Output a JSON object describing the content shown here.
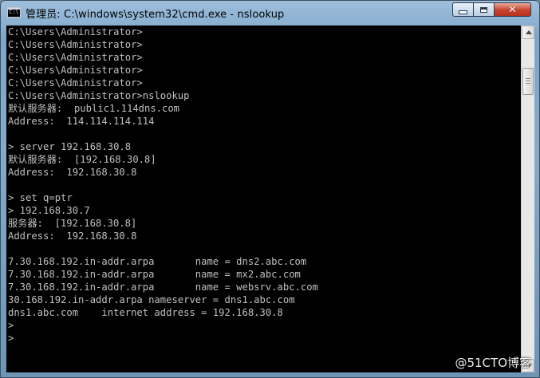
{
  "window": {
    "title": "管理员: C:\\windows\\system32\\cmd.exe - nslookup",
    "icon": "cmd-icon"
  },
  "controls": {
    "minimize": "minimize-icon",
    "maximize": "maximize-icon",
    "close": "close-icon",
    "close_glyph": "✕"
  },
  "console": {
    "lines": [
      "C:\\Users\\Administrator>",
      "C:\\Users\\Administrator>",
      "C:\\Users\\Administrator>",
      "C:\\Users\\Administrator>",
      "C:\\Users\\Administrator>",
      "C:\\Users\\Administrator>nslookup",
      "默认服务器:  public1.114dns.com",
      "Address:  114.114.114.114",
      "",
      "> server 192.168.30.8",
      "默认服务器:  [192.168.30.8]",
      "Address:  192.168.30.8",
      "",
      "> set q=ptr",
      "> 192.168.30.7",
      "服务器:  [192.168.30.8]",
      "Address:  192.168.30.8",
      "",
      "7.30.168.192.in-addr.arpa       name = dns2.abc.com",
      "7.30.168.192.in-addr.arpa       name = mx2.abc.com",
      "7.30.168.192.in-addr.arpa       name = websrv.abc.com",
      "30.168.192.in-addr.arpa nameserver = dns1.abc.com",
      "dns1.abc.com    internet address = 192.168.30.8",
      ">",
      ">"
    ],
    "text_color": "#c0c0c0",
    "background": "#000000"
  },
  "watermark": "@51CTO博客"
}
